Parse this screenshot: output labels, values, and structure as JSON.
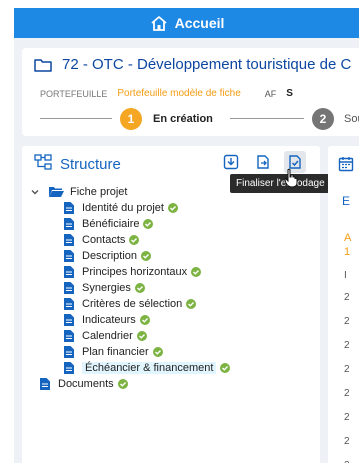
{
  "topbar": {
    "home_label": "Accueil"
  },
  "header": {
    "title": "72 - OTC - Développement touristique de C",
    "portefeuille_key": "PORTEFEUILLE",
    "portefeuille_value": "Portefeuille modèle de fiche",
    "af_key": "AF",
    "af_value": "S"
  },
  "steps": [
    {
      "number": "1",
      "label": "En création",
      "color": "#f5a623"
    },
    {
      "number": "2",
      "label": "Sour",
      "color": "#757575"
    }
  ],
  "structure": {
    "title": "Structure",
    "tooltip": "Finaliser l'encodage",
    "root": "Fiche projet",
    "items": [
      "Identité du projet",
      "Bénéficiaire",
      "Contacts",
      "Description",
      "Principes horizontaux",
      "Synergies",
      "Critères de sélection",
      "Indicateurs",
      "Calendrier",
      "Plan financier",
      "Échéancier & financement"
    ],
    "documents": "Documents"
  },
  "right_panel": {
    "letter_e": "E",
    "letter_a": "A",
    "digit_1": "1",
    "letter_l": "I",
    "rows": [
      "2",
      "2",
      "2",
      "2",
      "2",
      "2",
      "2",
      "2"
    ]
  },
  "colors": {
    "primary": "#1e88e5",
    "check": "#7cb342",
    "doc": "#1565c0",
    "accent": "#f5a623"
  }
}
